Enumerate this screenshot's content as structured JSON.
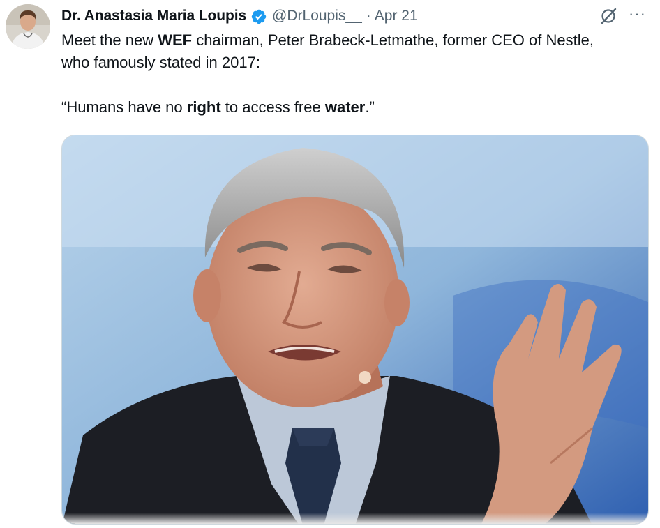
{
  "tweet": {
    "author_name": "Dr. Anastasia Maria Loupis",
    "handle": "@DrLoupis__",
    "separator": "·",
    "date": "Apr 21",
    "more_label": "···",
    "text_line1_part1": "Meet the new ",
    "text_line1_bold": "WEF",
    "text_line1_part2": " chairman, Peter Brabeck-Letmathe, former CEO of Nestle, who famously stated in 2017:",
    "quote_part1": "“Humans have no ",
    "quote_bold1": "right",
    "quote_part2": " to access free ",
    "quote_bold2": "water",
    "quote_part3": ".”"
  },
  "icons": {
    "verified": "verified-badge-icon",
    "grok": "grok-icon",
    "more": "more-icon"
  },
  "colors": {
    "primary_text": "#0f1419",
    "secondary_text": "#536471",
    "verified_blue": "#1d9bf0"
  }
}
